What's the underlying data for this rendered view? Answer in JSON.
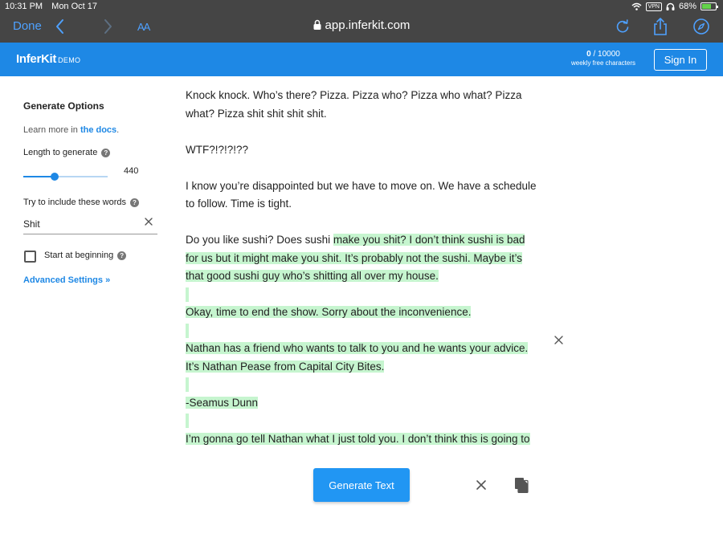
{
  "status_bar": {
    "time": "10:31 PM",
    "date": "Mon Oct 17",
    "vpn": "VPN",
    "battery": "68%",
    "battery_fraction": 0.68
  },
  "browser": {
    "done_label": "Done",
    "text_size_label": "AA",
    "url": "app.inferkit.com"
  },
  "app": {
    "brand": "InferKit",
    "brand_badge": "DEMO",
    "quota_used": "0",
    "quota_total": " / 10000",
    "quota_label": "weekly free characters",
    "sign_in_label": "Sign In"
  },
  "sidebar": {
    "title": "Generate Options",
    "learn_prefix": "Learn more in ",
    "learn_link": "the docs",
    "learn_suffix": ".",
    "length_label": "Length to generate",
    "length_value": "440",
    "length_fraction": 0.37,
    "words_label": "Try to include these words",
    "words_value": "Shit",
    "start_label": "Start at beginning",
    "start_checked": false,
    "advanced_label": "Advanced Settings »"
  },
  "document": {
    "p1": "Knock knock. Who’s there? Pizza. Pizza who? Pizza who what? Pizza what? Pizza shit shit shit shit.",
    "p2": "WTF?!?!?!??",
    "p3": "I know you’re disappointed but we have to move on. We have a schedule to follow. Time is tight.",
    "p4_plain": "Do you like sushi? Does sushi ",
    "p4_hl": "make you shit? I don’t think sushi is bad for us but it might make you shit. It’s probably not the sushi. Maybe it’s that good sushi guy who’s shitting all over my house.",
    "p5": "Okay, time to end the show. Sorry about the inconvenience.",
    "p6": "Nathan has a friend who wants to talk to you and he wants your advice. It’s Nathan Pease from Capital City Bites.",
    "p7": "-Seamus Dunn",
    "p8": "I’m gonna go tell Nathan what I just told you. I don’t think this is going to"
  },
  "actions": {
    "generate_label": "Generate Text"
  },
  "colors": {
    "accent": "#1e88e5",
    "button": "#2196f3",
    "highlight": "#c6f5cf",
    "chrome": "#454545"
  }
}
